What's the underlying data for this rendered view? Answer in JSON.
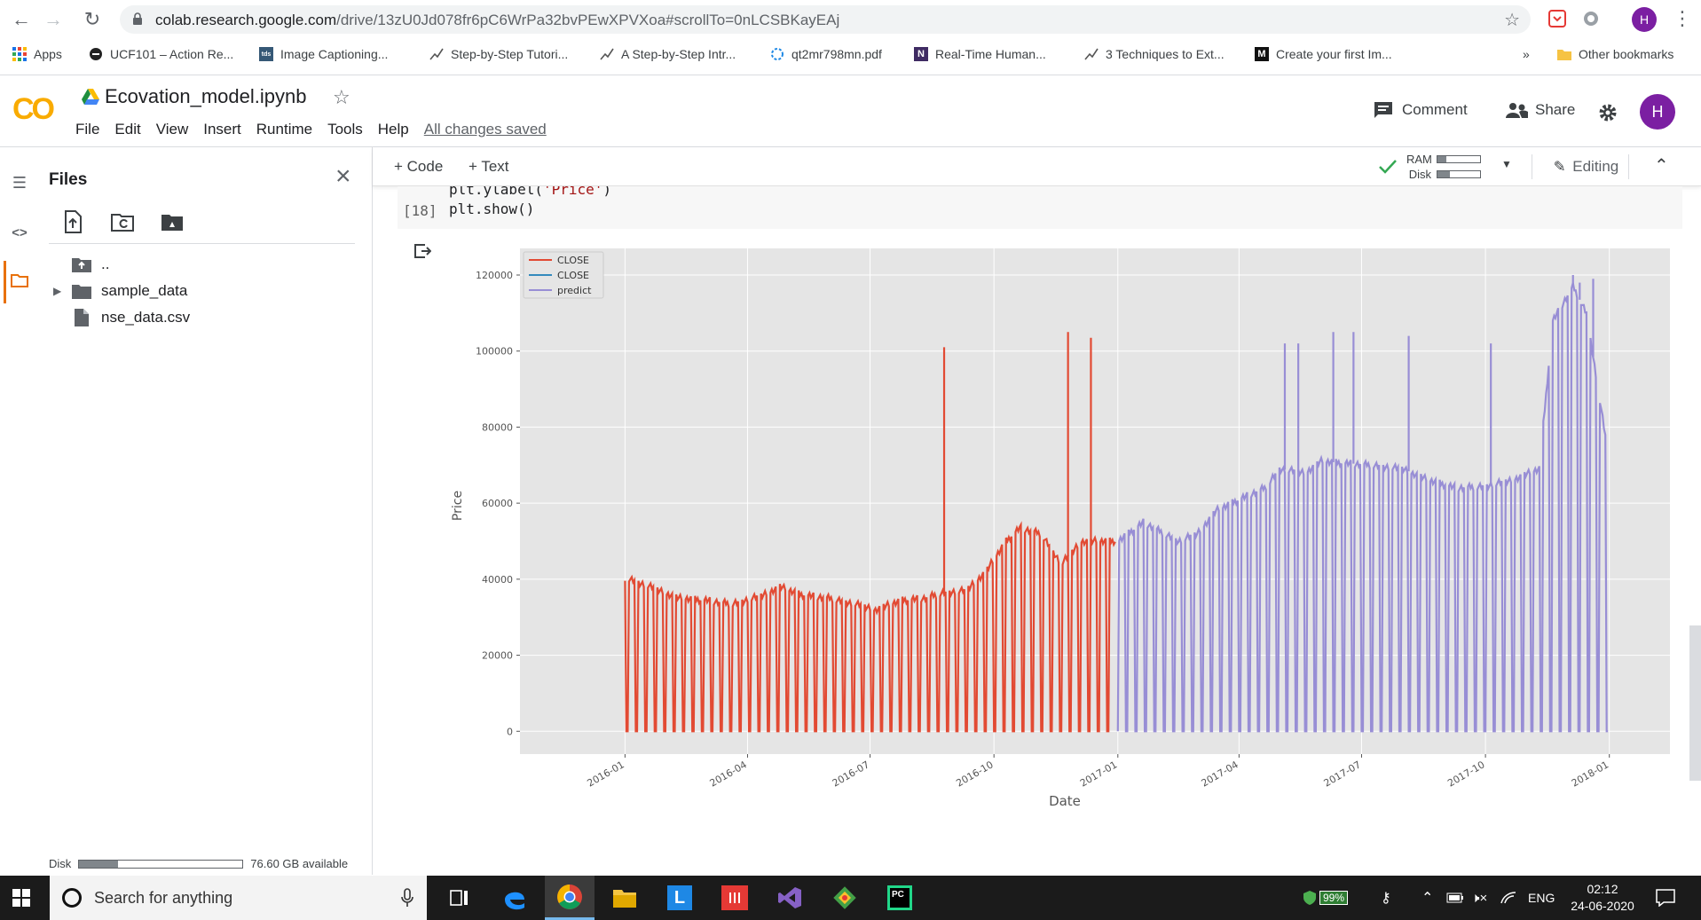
{
  "browser": {
    "url_host": "colab.research.google.com",
    "url_path": "/drive/13zU0Jd078fr6pC6WrPa32bvPEwXPVXoa#scrollTo=0nLCSBKayEAj",
    "profile_initial": "H",
    "bookmarks": [
      {
        "label": "Apps",
        "icon": "apps-grid-icon"
      },
      {
        "label": "UCF101 – Action Re...",
        "icon": "ucf-icon"
      },
      {
        "label": "Image Captioning...",
        "icon": "tds-icon"
      },
      {
        "label": "Step-by-Step Tutori...",
        "icon": "arrow-chart-icon"
      },
      {
        "label": "A Step-by-Step Intr...",
        "icon": "arrow-chart-icon"
      },
      {
        "label": "qt2mr798mn.pdf",
        "icon": "pdf-spinner-icon"
      },
      {
        "label": "Real-Time Human...",
        "icon": "n-logo-icon"
      },
      {
        "label": "3 Techniques to Ext...",
        "icon": "arrow-chart-icon"
      },
      {
        "label": "Create your first Im...",
        "icon": "medium-logo-icon"
      }
    ],
    "overflow": "»",
    "other_bookmarks": "Other bookmarks"
  },
  "colab": {
    "logo": "CO",
    "notebook_title": "Ecovation_model.ipynb",
    "menu": [
      "File",
      "Edit",
      "View",
      "Insert",
      "Runtime",
      "Tools",
      "Help"
    ],
    "save_status": "All changes saved",
    "comment_label": "Comment",
    "share_label": "Share",
    "avatar_initial": "H"
  },
  "files_panel": {
    "title": "Files",
    "tree": [
      {
        "name": "..",
        "type": "parent"
      },
      {
        "name": "sample_data",
        "type": "folder"
      },
      {
        "name": "nse_data.csv",
        "type": "file"
      }
    ],
    "disk_label": "Disk",
    "disk_available": "76.60 GB available",
    "disk_used_fraction": 0.24
  },
  "toolbar": {
    "code_label": "+ Code",
    "text_label": "+ Text",
    "ram_label": "RAM",
    "disk_label": "Disk",
    "ram_fraction": 0.2,
    "disk_fraction": 0.3,
    "editing_label": "Editing"
  },
  "cell": {
    "count": "[18]",
    "prev_line_code": "plt.ylabel(",
    "prev_line_str": "'Price'",
    "prev_line_end": ")",
    "code": "plt.show()"
  },
  "chart_data": {
    "type": "line",
    "xlabel": "Date",
    "ylabel": "Price",
    "x_ticks": [
      "2016-01",
      "2016-04",
      "2016-07",
      "2016-10",
      "2017-01",
      "2017-04",
      "2017-07",
      "2017-10",
      "2018-01"
    ],
    "y_ticks": [
      0,
      20000,
      40000,
      60000,
      80000,
      100000,
      120000
    ],
    "ylim": [
      -6000,
      127000
    ],
    "xlim": [
      "2015-10-15",
      "2018-02-15"
    ],
    "grid": true,
    "legend_position": "top-left",
    "series": [
      {
        "name": "CLOSE",
        "color": "#e24a33",
        "x_range": [
          "2016-01-01",
          "2016-12-30"
        ],
        "envelope": [
          [
            "2016-01-01",
            40500
          ],
          [
            "2016-01-20",
            38000
          ],
          [
            "2016-02-10",
            35000
          ],
          [
            "2016-03-01",
            34500
          ],
          [
            "2016-03-20",
            33500
          ],
          [
            "2016-04-10",
            35500
          ],
          [
            "2016-04-25",
            38000
          ],
          [
            "2016-05-10",
            36000
          ],
          [
            "2016-06-01",
            35000
          ],
          [
            "2016-06-20",
            33500
          ],
          [
            "2016-07-05",
            32000
          ],
          [
            "2016-07-25",
            34500
          ],
          [
            "2016-08-10",
            35000
          ],
          [
            "2016-08-25",
            36500
          ],
          [
            "2016-09-10",
            37000
          ],
          [
            "2016-09-25",
            42000
          ],
          [
            "2016-10-10",
            50000
          ],
          [
            "2016-10-20",
            53500
          ],
          [
            "2016-11-05",
            52000
          ],
          [
            "2016-11-20",
            44000
          ],
          [
            "2016-12-05",
            50000
          ],
          [
            "2016-12-30",
            50000
          ]
        ],
        "spikes": [
          [
            "2016-08-25",
            101000
          ],
          [
            "2016-11-25",
            105000
          ],
          [
            "2016-12-12",
            103500
          ]
        ]
      },
      {
        "name": "CLOSE",
        "color": "#348abd",
        "values": []
      },
      {
        "name": "predict",
        "color": "#988ed5",
        "x_range": [
          "2017-01-01",
          "2017-12-31"
        ],
        "envelope": [
          [
            "2017-01-01",
            50000
          ],
          [
            "2017-01-20",
            55000
          ],
          [
            "2017-02-15",
            50000
          ],
          [
            "2017-03-01",
            52000
          ],
          [
            "2017-03-15",
            58000
          ],
          [
            "2017-04-01",
            61000
          ],
          [
            "2017-04-20",
            64000
          ],
          [
            "2017-05-01",
            69000
          ],
          [
            "2017-05-20",
            68000
          ],
          [
            "2017-06-01",
            71000
          ],
          [
            "2017-06-20",
            70500
          ],
          [
            "2017-07-10",
            70000
          ],
          [
            "2017-08-01",
            69000
          ],
          [
            "2017-08-20",
            66000
          ],
          [
            "2017-09-10",
            64000
          ],
          [
            "2017-10-01",
            64500
          ],
          [
            "2017-10-20",
            66000
          ],
          [
            "2017-11-10",
            69000
          ],
          [
            "2017-11-20",
            108000
          ],
          [
            "2017-12-05",
            117000
          ],
          [
            "2017-12-15",
            110000
          ],
          [
            "2017-12-31",
            73000
          ]
        ],
        "spikes": [
          [
            "2017-05-05",
            102000
          ],
          [
            "2017-05-15",
            102000
          ],
          [
            "2017-06-10",
            105000
          ],
          [
            "2017-06-25",
            105000
          ],
          [
            "2017-08-05",
            104000
          ],
          [
            "2017-10-05",
            102000
          ],
          [
            "2017-12-05",
            120000
          ],
          [
            "2017-12-10",
            118000
          ],
          [
            "2017-12-20",
            119000
          ]
        ]
      }
    ]
  },
  "taskbar": {
    "search_placeholder": "Search for anything",
    "battery": "99%",
    "language": "ENG",
    "time": "02:12",
    "date": "24-06-2020"
  }
}
